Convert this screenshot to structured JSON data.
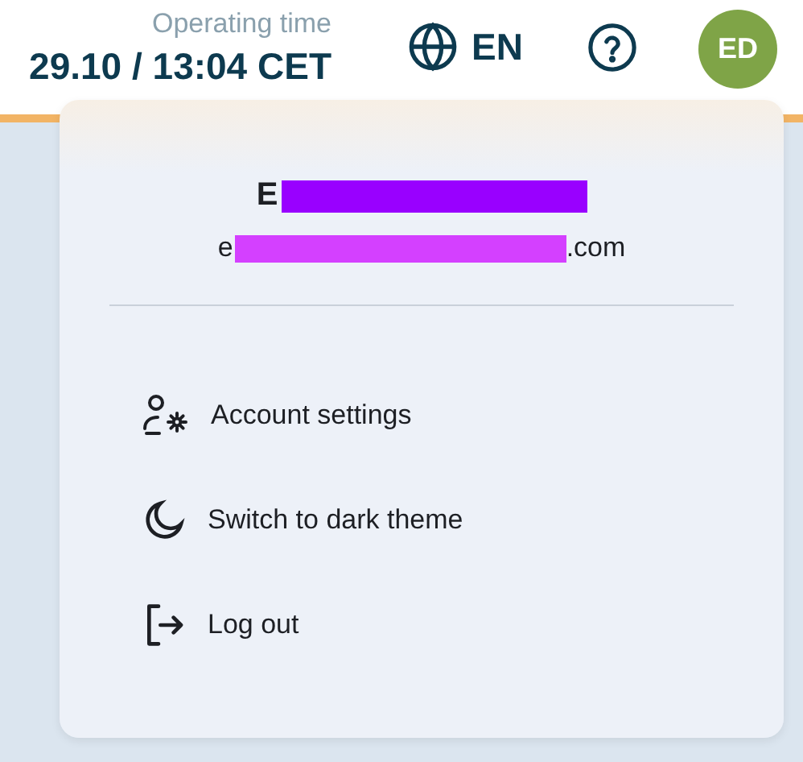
{
  "header": {
    "operating_time_label": "Operating time",
    "operating_time": "29.10 / 13:04 CET",
    "language": "EN",
    "avatar_initials": "ED"
  },
  "user_menu": {
    "name_visible": "E",
    "email_start": "e",
    "email_end": ".com",
    "items": [
      {
        "kind": "settings",
        "label": "Account settings"
      },
      {
        "kind": "theme",
        "label": "Switch to dark theme"
      },
      {
        "kind": "logout",
        "label": "Log out"
      }
    ]
  }
}
